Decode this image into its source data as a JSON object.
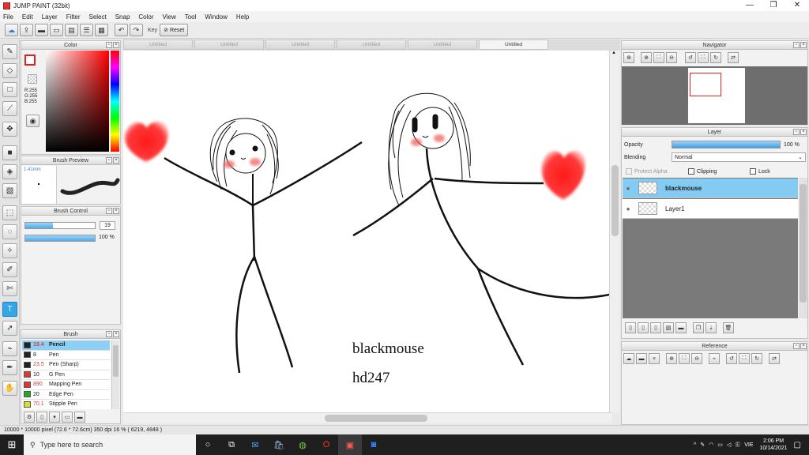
{
  "titlebar": {
    "title": "JUMP PAINT (32bit)",
    "minimize": "—",
    "restore": "❐",
    "close": "✕"
  },
  "menu": [
    "File",
    "Edit",
    "Layer",
    "Filter",
    "Select",
    "Snap",
    "Color",
    "View",
    "Tool",
    "Window",
    "Help"
  ],
  "toolbar": {
    "key_label": "Key",
    "reset_label": "Reset"
  },
  "tabs": [
    "Untitled",
    "Untitled",
    "Untitled",
    "Untitled",
    "Untitled",
    "Untitled"
  ],
  "color_panel": {
    "title": "Color",
    "r": "R:255",
    "g": "G:255",
    "b": "B:255",
    "selected_color": "#ff0000"
  },
  "brush_preview": {
    "title": "Brush Preview",
    "size": "1.41mm"
  },
  "brush_control": {
    "title": "Brush Control",
    "size_value": "19",
    "opacity_value": "100 %",
    "size_fraction": 0.4,
    "opacity_fraction": 1.0
  },
  "brush_panel": {
    "title": "Brush",
    "items": [
      {
        "size": "19.4",
        "name": "Pencil",
        "color": "#222222"
      },
      {
        "size": "8",
        "name": "Pen",
        "color": "#222222"
      },
      {
        "size": "23.5",
        "name": "Pen (Sharp)",
        "color": "#222222"
      },
      {
        "size": "10",
        "name": "G Pen",
        "color": "#e33333"
      },
      {
        "size": "890",
        "name": "Mapping Pen",
        "color": "#e33333"
      },
      {
        "size": "20",
        "name": "Edge Pen",
        "color": "#22aa22"
      },
      {
        "size": "70.1",
        "name": "Stipple Pen",
        "color": "#dddd22"
      }
    ]
  },
  "canvas": {
    "text1": "blackmouse",
    "text2": "hd247"
  },
  "navigator": {
    "title": "Navigator"
  },
  "layer_panel": {
    "title": "Layer",
    "opacity_label": "Opacity",
    "opacity_value": "100 %",
    "opacity_fraction": 1.0,
    "blending_label": "Blending",
    "blending_value": "Normal",
    "protect_alpha": "Protect Alpha",
    "clipping": "Clipping",
    "lock": "Lock",
    "layers": [
      {
        "name": "blackmouse",
        "selected": true
      },
      {
        "name": "Layer1",
        "selected": false
      }
    ]
  },
  "reference": {
    "title": "Reference"
  },
  "status": "10000 * 10000 pixel   (72.6 * 72.6cm)   350 dpi   16 %   ( 6219, 4848 )",
  "taskbar": {
    "search_placeholder": "Type here to search",
    "lang": "VIE",
    "time": "2:06 PM",
    "date": "10/14/2021"
  }
}
